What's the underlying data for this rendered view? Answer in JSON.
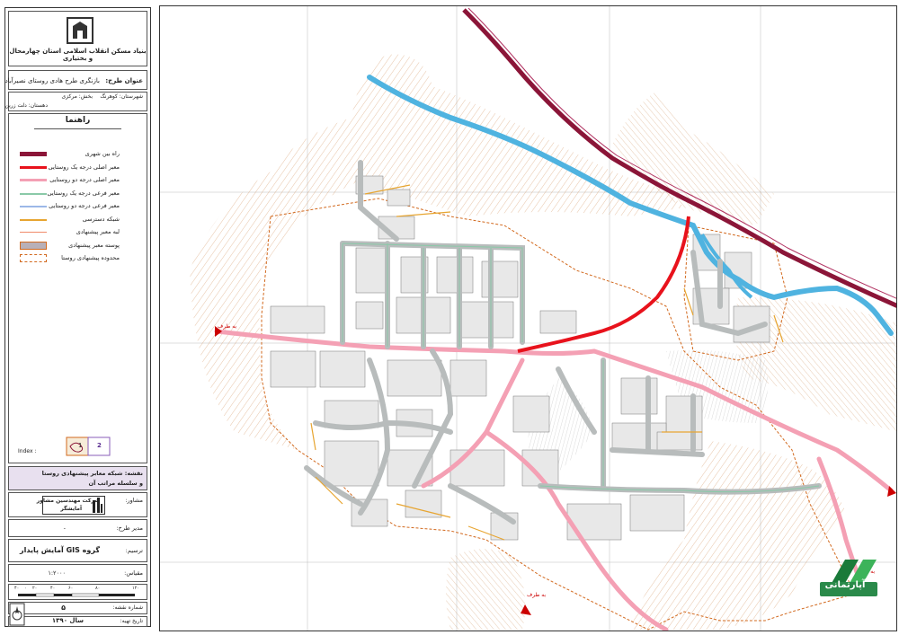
{
  "title_block": {
    "org_line1": "بنیاد مسکن انقلاب اسلامی استان چهارمحال و بختیاری",
    "org_line2": "",
    "project_label": "عنوان طرح:",
    "project_title": "بازنگری طرح هادی روستای نصیرآباد",
    "county": "شهرستان: کوهرنگ",
    "district": "بخش: مرکزی",
    "village": "",
    "dehestan": "دهستان: دلت زرین",
    "legend_title": "راهنما",
    "legend": [
      {
        "label": "راه بین شهری",
        "color": "#8b1538",
        "style": "thick"
      },
      {
        "label": "معبر اصلی درجه یک روستایی",
        "color": "#e8121c",
        "style": "medium"
      },
      {
        "label": "معبر اصلی درجه دو روستایی",
        "color": "#f4a0b4",
        "style": "medium"
      },
      {
        "label": "معبر فرعی درجه یک روستایی",
        "color": "#8ac9a8",
        "style": "thin"
      },
      {
        "label": "معبر فرعی درجه دو روستایی",
        "color": "#9cb8e8",
        "style": "thin"
      },
      {
        "label": "شبکه دسترسی",
        "color": "#e7a531",
        "style": "thin"
      },
      {
        "label": "لبه معبر پیشنهادی",
        "color": "#f08a6a",
        "style": "hair"
      },
      {
        "label": "پوسته معبر پیشنهادی",
        "color": "#b8b0b8",
        "style": "fill"
      },
      {
        "label": "محدوده پیشنهادی روستا",
        "color": "#d2691e",
        "style": "dashed"
      }
    ],
    "index_label": "Index :",
    "index_numbers": [
      "1",
      "2"
    ],
    "map_name_label": "نقشه: شبکه معابر پیشنهادی روستا",
    "map_name_line2": "و سلسله مراتب آن",
    "consultant_label": "مشاور:",
    "consultant_name": "شرکت مهندسین مشاور",
    "consultant_name2": "آمایشگر",
    "manager_label": "مدیر طرح:",
    "manager_value": "-",
    "drafter_label": "ترسیم:",
    "drafter_value": "گروه GIS آمایش پایدار",
    "scale_label": "مقیاس:",
    "scale_value": "۱:۲۰۰۰",
    "scale_ticks": [
      "۱۲۰",
      "۸۰",
      "۶۰",
      "۴۰",
      "۲۰",
      "۰",
      "۴۰"
    ],
    "sheet_number_label": "شماره نقشه:",
    "sheet_number": "۵",
    "date_label": "تاریخ تهیه:",
    "date_value": "سال ۱۳۹۰"
  },
  "map": {
    "labels": [
      "به طرف",
      "به طرف",
      "به طرف"
    ],
    "watermark": "آپارتمانی"
  },
  "colors": {
    "intercity_road": "#8b1538",
    "main_road_1": "#e8121c",
    "main_road_2": "#f4a0b4",
    "river": "#4fb3e0",
    "contours": "#c8874a",
    "boundary": "#d2691e",
    "road_fill": "#b8bcbc"
  }
}
